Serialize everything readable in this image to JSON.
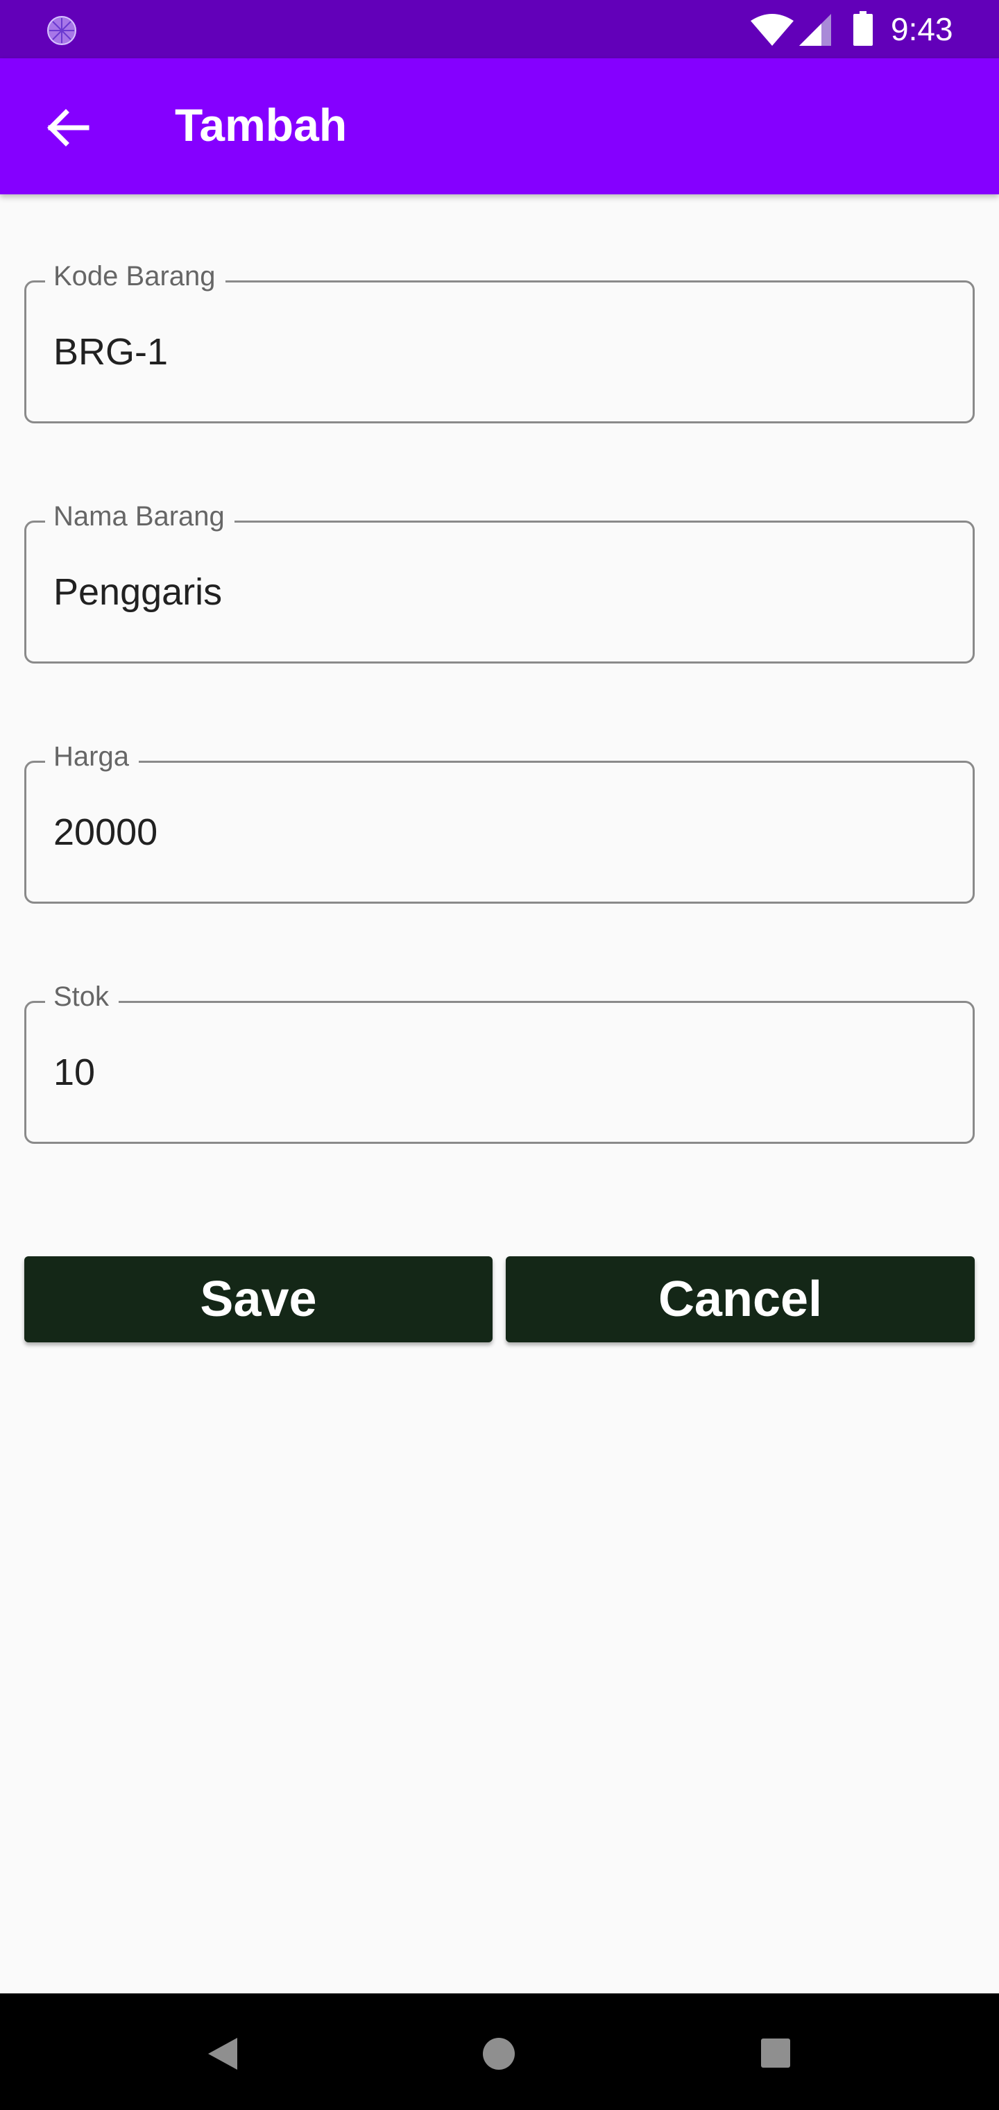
{
  "status_bar": {
    "time": "9:43",
    "icons": [
      "app-notification-icon",
      "wifi-icon",
      "signal-icon",
      "battery-icon"
    ]
  },
  "app_bar": {
    "title": "Tambah",
    "back_icon": "arrow-back-icon"
  },
  "form": {
    "fields": [
      {
        "label": "Kode Barang",
        "value": "BRG-1"
      },
      {
        "label": "Nama Barang",
        "value": "Penggaris"
      },
      {
        "label": "Harga",
        "value": "20000"
      },
      {
        "label": "Stok",
        "value": "10"
      }
    ]
  },
  "buttons": {
    "save_label": "Save",
    "cancel_label": "Cancel"
  },
  "nav_bar": {
    "icons": [
      "back-triangle-icon",
      "home-circle-icon",
      "recents-square-icon"
    ]
  },
  "colors": {
    "status_bar": "#6200b9",
    "app_bar": "#8500ff",
    "button_bg": "#142717",
    "background": "#fafafa"
  }
}
